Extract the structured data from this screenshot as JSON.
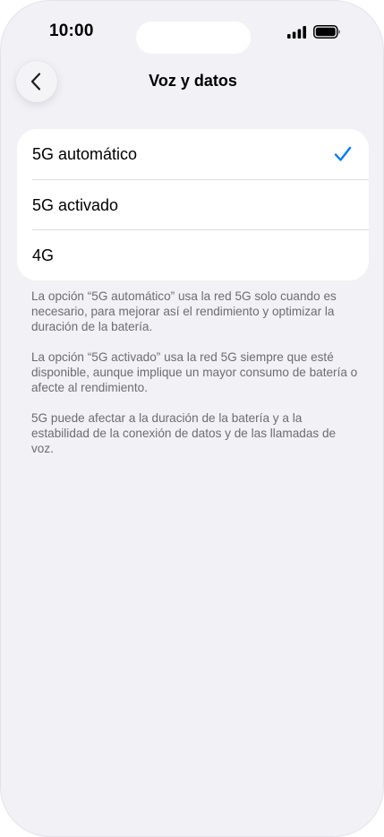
{
  "status_bar": {
    "time": "10:00",
    "icons": [
      "signal-icon",
      "battery-icon"
    ]
  },
  "nav": {
    "back_icon": "chevron-left-icon",
    "title": "Voz y datos"
  },
  "options": [
    {
      "label": "5G automático",
      "selected": true
    },
    {
      "label": "5G activado",
      "selected": false
    },
    {
      "label": "4G",
      "selected": false
    }
  ],
  "footnotes": [
    "La opción “5G automático” usa la red 5G solo cuando es necesario, para mejorar así el rendimiento y optimizar la duración de la batería.",
    "La opción “5G activado” usa la red 5G siempre que esté disponible, aunque implique un mayor consumo de batería o afecte al rendimiento.",
    "5G puede afectar a la duración de la batería y a la estabilidad de la conexión de datos y de las llamadas de voz."
  ],
  "colors": {
    "background": "#f2f1f6",
    "card": "#ffffff",
    "accent": "#007aff",
    "secondary_text": "#6c6c72"
  }
}
